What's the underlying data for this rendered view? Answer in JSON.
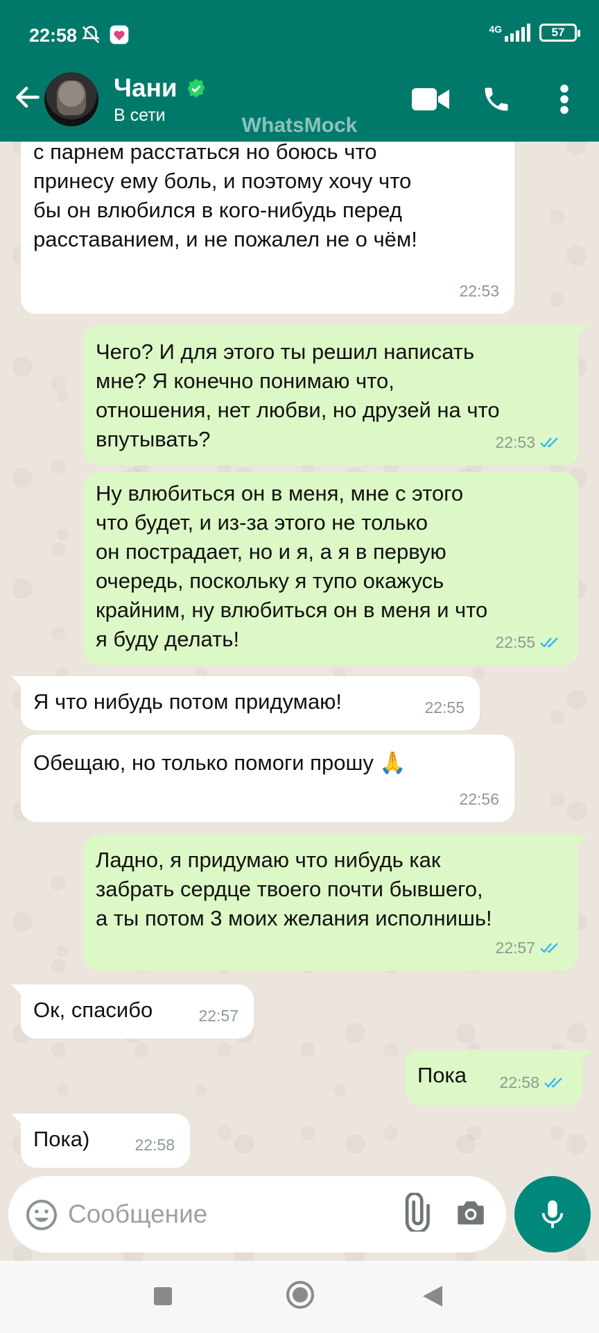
{
  "status_bar": {
    "time": "22:58",
    "network": "4G",
    "battery": "57"
  },
  "header": {
    "contact_name": "Чани",
    "contact_status": "В сети",
    "watermark": "WhatsMock"
  },
  "messages": [
    {
      "direction": "in",
      "text": "Понимаешь ли? Тут такое дело, я хочу\nс парнем расстаться но боюсь что\nпринесу ему боль, и поэтому хочу что\nбы он влюбился в кого-нибудь перед\nрасставанием, и не пожалел не о чём!",
      "time": "22:53"
    },
    {
      "direction": "out",
      "text": "Чего? И для этого ты решил написать\nмне? Я конечно понимаю что,\nотношения, нет любви, но друзей на что\nвпутывать?",
      "time": "22:53",
      "read": true
    },
    {
      "direction": "out",
      "text": "Ну влюбиться он в меня, мне с этого\nчто будет, и из-за этого не только\nон пострадает, но и я, а я в первую\nочередь, поскольку я тупо окажусь\nкрайним, ну влюбиться он в меня и что\nя буду делать!",
      "time": "22:55",
      "read": true
    },
    {
      "direction": "in",
      "text": "Я что нибудь потом придумаю!",
      "time": "22:55"
    },
    {
      "direction": "in",
      "text": "Обещаю, но только помоги прошу 🙏",
      "time": "22:56"
    },
    {
      "direction": "out",
      "text": "Ладно, я придумаю что нибудь как\nзабрать сердце твоего почти бывшего,\nа ты потом 3 моих желания исполнишь!",
      "time": "22:57",
      "read": true
    },
    {
      "direction": "in",
      "text": "Ок, спасибо",
      "time": "22:57"
    },
    {
      "direction": "out",
      "text": "Пока",
      "time": "22:58",
      "read": true
    },
    {
      "direction": "in",
      "text": "Пока)",
      "time": "22:58"
    }
  ],
  "input": {
    "placeholder": "Сообщение"
  },
  "colors": {
    "header": "#00796b",
    "outgoing_bubble": "#dcf8c6",
    "incoming_bubble": "#ffffff",
    "read_ticks": "#34b7f1",
    "mic_button": "#00897b"
  },
  "icons": [
    "back-arrow-icon",
    "verified-icon",
    "video-call-icon",
    "phone-icon",
    "more-vert-icon",
    "emoji-icon",
    "attach-icon",
    "camera-icon",
    "mic-icon",
    "nav-square-icon",
    "nav-circle-icon",
    "nav-triangle-icon"
  ]
}
